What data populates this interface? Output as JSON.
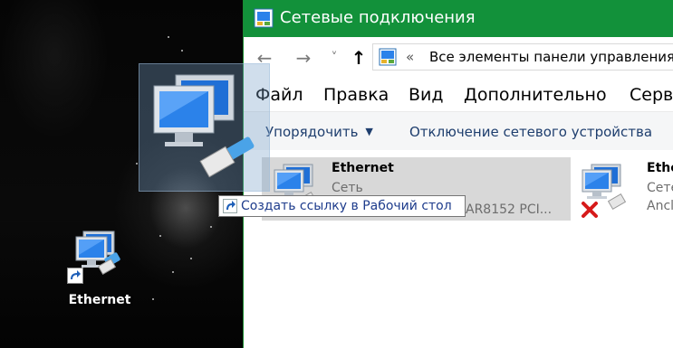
{
  "window": {
    "title": "Сетевые подключения",
    "address_separator": "«",
    "address_path": "Все элементы панели управления"
  },
  "nav": {
    "back": "←",
    "forward": "→",
    "recent": "˅",
    "up": "↑"
  },
  "menu": [
    "Файл",
    "Правка",
    "Вид",
    "Дополнительно",
    "Серви"
  ],
  "commands": {
    "organize": "Упорядочить",
    "disable_device": "Отключение сетевого устройства"
  },
  "connections": [
    {
      "name": "Ethernet",
      "status": "Сеть",
      "device": "AR8152 PCI...",
      "selected": true,
      "disconnected": false
    },
    {
      "name": "Ethe",
      "status": "Сете",
      "device": "Ancl",
      "selected": false,
      "disconnected": true
    }
  ],
  "drag_tooltip": "Создать ссылку в Рабочий стол",
  "desktop_icon": {
    "label": "Ethernet",
    "shortcut_icon": "shortcut-arrow-icon"
  },
  "colors": {
    "titlebar": "#12913a",
    "command_text": "#1e3e6e",
    "tooltip_text": "#1e3c8c",
    "selection": "#d8d8d8"
  }
}
